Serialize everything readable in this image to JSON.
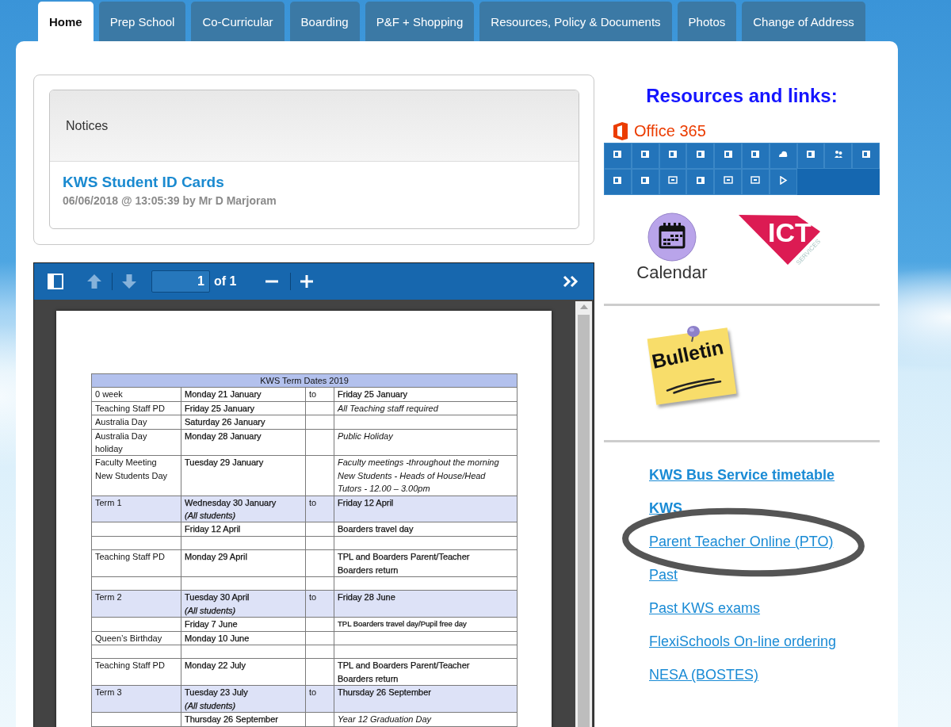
{
  "tabs": [
    {
      "label": "Home",
      "selected": true
    },
    {
      "label": "Prep School",
      "selected": false
    },
    {
      "label": "Co-Curricular",
      "selected": false
    },
    {
      "label": "Boarding",
      "selected": false
    },
    {
      "label": "P&F + Shopping",
      "selected": false
    },
    {
      "label": "Resources, Policy & Documents",
      "selected": false
    },
    {
      "label": "Photos",
      "selected": false
    },
    {
      "label": "Change of Address",
      "selected": false
    }
  ],
  "notices": {
    "title": "Notices",
    "items": [
      {
        "title": "KWS Student ID Cards",
        "meta": "06/06/2018 @ 13:05:39 by Mr D Marjoram"
      }
    ]
  },
  "pdf_viewer": {
    "toolbar": {
      "items": [
        {
          "kind": "sidebar",
          "disabled": false
        },
        {
          "kind": "previous",
          "disabled": true
        },
        {
          "kind": "next",
          "disabled": true
        },
        {
          "kind": "page_field",
          "value": "1"
        },
        {
          "kind": "page_count",
          "text": "of 1"
        },
        {
          "kind": "zoom_out",
          "disabled": false
        },
        {
          "kind": "zoom_in",
          "disabled": false
        },
        {
          "kind": "tools",
          "disabled": false
        }
      ]
    },
    "table": {
      "title": "KWS Term Dates 2019",
      "rows": [
        {
          "kind": "entry",
          "shaded": false,
          "column_1": "0 week",
          "column_2": "Monday 21 January",
          "column_3": "to",
          "column_4": "Friday 25 January",
          "column_4_italic": false,
          "column_4_small": false
        },
        {
          "kind": "entry",
          "shaded": false,
          "column_1": "Teaching Staff PD",
          "column_2": "Friday 25 January",
          "column_4": "All Teaching staff required",
          "column_4_italic": true,
          "column_4_small": false
        },
        {
          "kind": "entry",
          "shaded": false,
          "column_1": "Australia Day",
          "column_2": "Saturday 26 January"
        },
        {
          "kind": "entry",
          "shaded": false,
          "column_1": "Australia Day\nholiday",
          "column_2": "Monday 28 January",
          "column_4": "Public Holiday",
          "column_4_italic": true,
          "column_4_small": false
        },
        {
          "kind": "entry",
          "shaded": false,
          "column_1": "Faculty Meeting\nNew Students Day",
          "column_2": "Tuesday 29 January",
          "column_4": "Faculty meetings -throughout the morning\nNew Students - Heads of House/Head\nTutors - 12.00 – 3.00pm",
          "column_4_italic": true,
          "column_4_small": false
        },
        {
          "kind": "entry",
          "shaded": true,
          "column_1": "Term 1",
          "column_2": "Wednesday 30 January\n*(All students)*",
          "column_3": "to",
          "column_4": "Friday 12 April",
          "column_4_italic": false,
          "column_4_small": false
        },
        {
          "kind": "entry",
          "shaded": false,
          "column_2": "Friday 12 April",
          "column_4": "Boarders travel day",
          "column_4_italic": false,
          "column_4_small": false
        },
        {
          "kind": "blank",
          "shaded": false
        },
        {
          "kind": "entry",
          "shaded": false,
          "column_1": "Teaching Staff PD",
          "column_2": "Monday 29 April",
          "column_4": "TPL and Boarders Parent/Teacher\nBoarders return",
          "column_4_italic": false,
          "column_4_small": false
        },
        {
          "kind": "blank",
          "shaded": false
        },
        {
          "kind": "entry",
          "shaded": true,
          "column_1": "Term 2",
          "column_2": "Tuesday 30 April\n*(All students)*",
          "column_3": "to",
          "column_4": "Friday 28 June",
          "column_4_italic": false,
          "column_4_small": false
        },
        {
          "kind": "entry",
          "shaded": false,
          "column_2": "Friday 7 June",
          "column_4": "TPL Boarders travel day/Pupil free day",
          "column_4_italic": false,
          "column_4_small": true
        },
        {
          "kind": "entry",
          "shaded": false,
          "column_1": "Queen’s Birthday",
          "column_2": "Monday 10 June"
        },
        {
          "kind": "blank",
          "shaded": false
        },
        {
          "kind": "entry",
          "shaded": false,
          "column_1": "Teaching Staff PD",
          "column_2": "Monday 22 July",
          "column_4": "TPL and Boarders Parent/Teacher\nBoarders return",
          "column_4_italic": false,
          "column_4_small": false
        },
        {
          "kind": "entry",
          "shaded": true,
          "column_1": "Term 3",
          "column_2": "Tuesday 23 July\n*(All students)*",
          "column_3": "to",
          "column_4": "Thursday 26 September",
          "column_4_italic": false,
          "column_4_small": false
        },
        {
          "kind": "entry",
          "shaded": false,
          "column_2": "Thursday 26 September",
          "column_4": "Year 12 Graduation Day",
          "column_4_italic": true,
          "column_4_small": false
        }
      ]
    }
  },
  "sidebar": {
    "heading": "Resources and links:",
    "office_logo": {
      "text": "Office 365"
    },
    "calendar": {
      "label": "Calendar"
    },
    "ict_logo": {
      "title": "ICT",
      "subtitle": "SERVICES"
    },
    "bulletin": {
      "label": "Bulletin"
    },
    "links": [
      {
        "text": "KWS Bus Service timetable",
        "bold": true,
        "circled": false
      },
      {
        "text": "KWS",
        "bold": true,
        "circled": false
      },
      {
        "text": "Parent Teacher Online (PTO)",
        "bold": false,
        "circled": true
      },
      {
        "text": "Past",
        "bold": false,
        "circled": false
      },
      {
        "text": "Past KWS exams",
        "bold": false,
        "circled": false
      },
      {
        "text": "FlexiSchools On-line ordering",
        "bold": false,
        "circled": false
      },
      {
        "text": "NESA (BOSTES)",
        "bold": false,
        "circled": false
      }
    ]
  }
}
